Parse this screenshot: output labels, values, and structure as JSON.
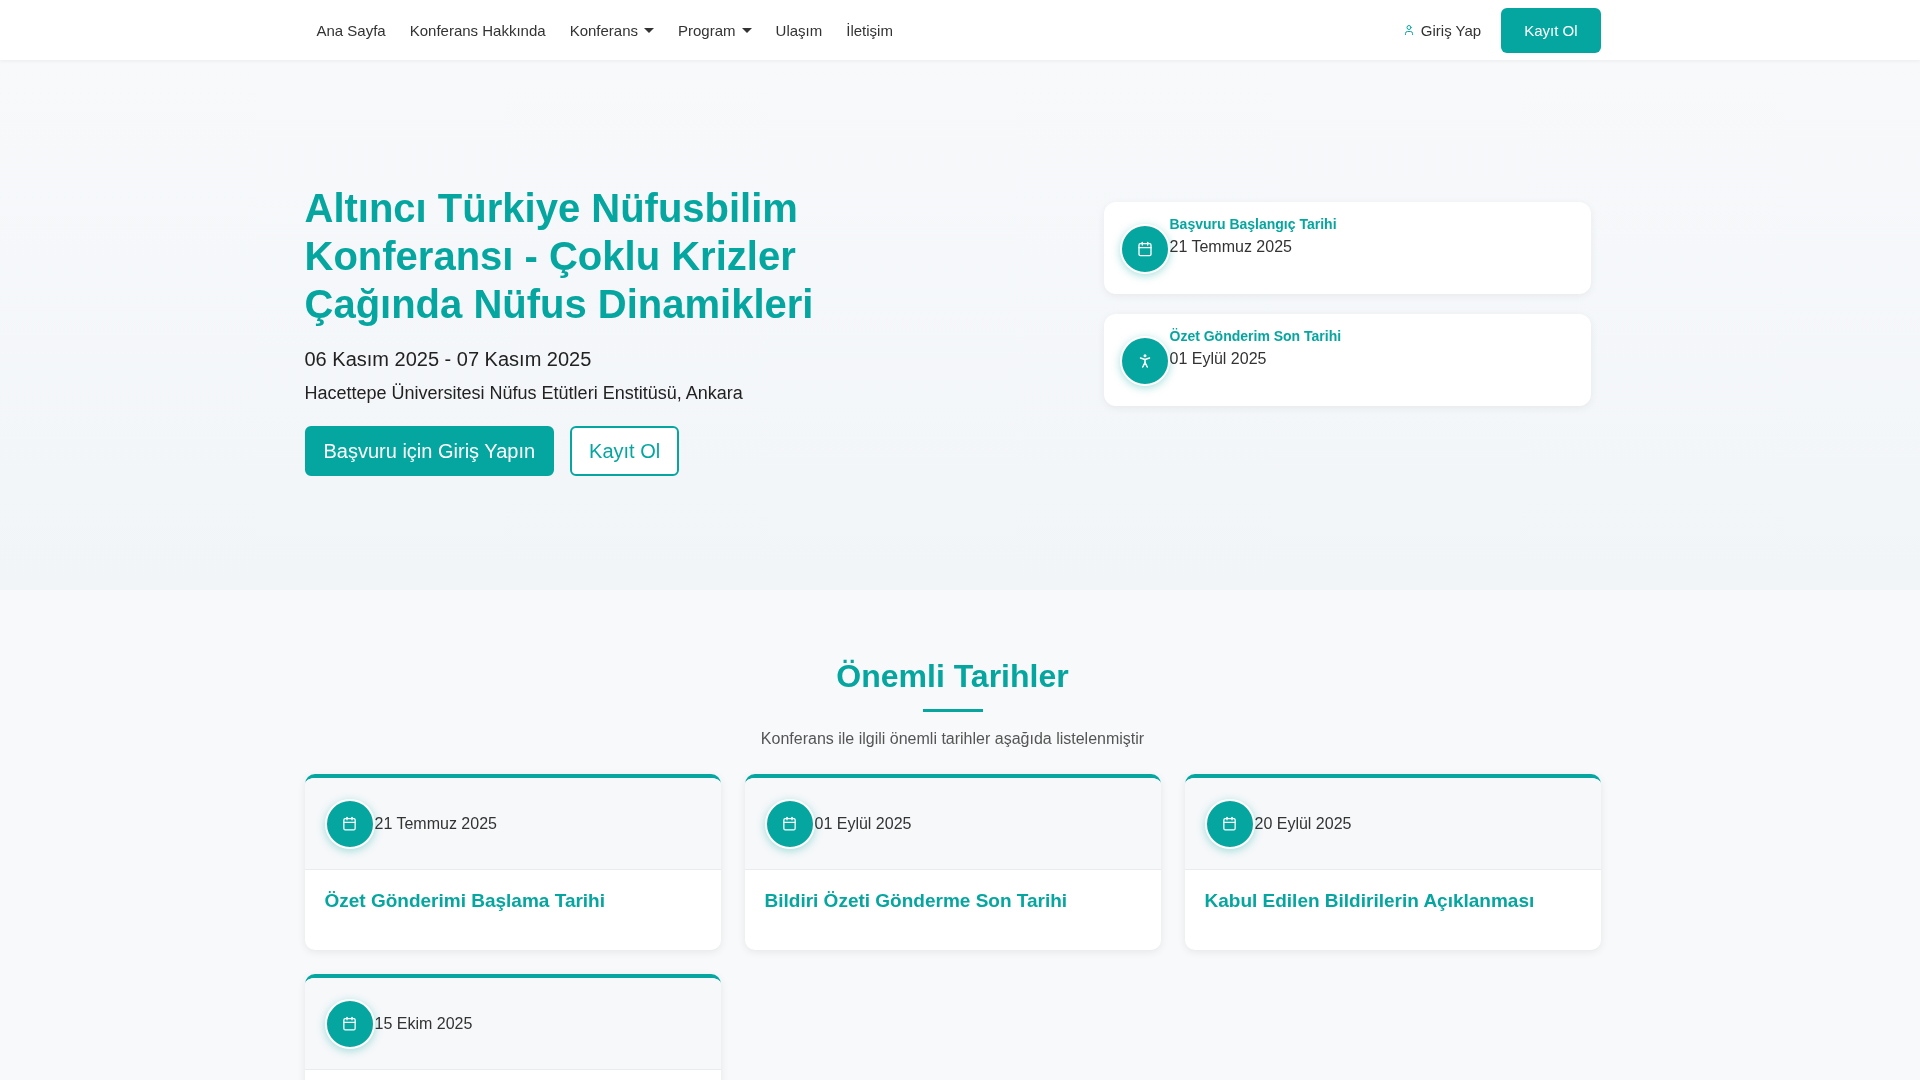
{
  "navbar": {
    "items": [
      {
        "label": "Ana Sayfa",
        "dropdown": false
      },
      {
        "label": "Konferans Hakkında",
        "dropdown": false
      },
      {
        "label": "Konferans",
        "dropdown": true
      },
      {
        "label": "Program",
        "dropdown": true
      },
      {
        "label": "Ulaşım",
        "dropdown": false
      },
      {
        "label": "İletişim",
        "dropdown": false
      }
    ],
    "login": "Giriş Yap",
    "register": "Kayıt Ol"
  },
  "hero": {
    "title": "Altıncı Türkiye Nüfusbilim Konferansı - Çoklu Krizler Çağında Nüfus Dinamikleri",
    "dates": "06 Kasım 2025 - 07 Kasım 2025",
    "venue": "Hacettepe Üniversitesi Nüfus Etütleri Enstitüsü, Ankara",
    "primary_button": "Başvuru için Giriş Yapın",
    "secondary_button": "Kayıt Ol",
    "date_cards": [
      {
        "kind": "calendar",
        "label": "Başvuru Başlangıç Tarihi",
        "date": "21 Temmuz 2025"
      },
      {
        "kind": "runner",
        "label": "Özet Gönderim Son Tarihi",
        "date": "01 Eylül 2025"
      }
    ]
  },
  "important_dates": {
    "title": "Önemli Tarihler",
    "subtitle": "Konferans ile ilgili önemli tarihler aşağıda listelenmiştir",
    "cards": [
      {
        "date": "21 Temmuz 2025",
        "title": "Özet Gönderimi Başlama Tarihi"
      },
      {
        "date": "01 Eylül 2025",
        "title": "Bildiri Özeti Gönderme Son Tarihi"
      },
      {
        "date": "20 Eylül 2025",
        "title": "Kabul Edilen Bildirilerin Açıklanması"
      },
      {
        "date": "15 Ekim 2025"
      }
    ]
  }
}
